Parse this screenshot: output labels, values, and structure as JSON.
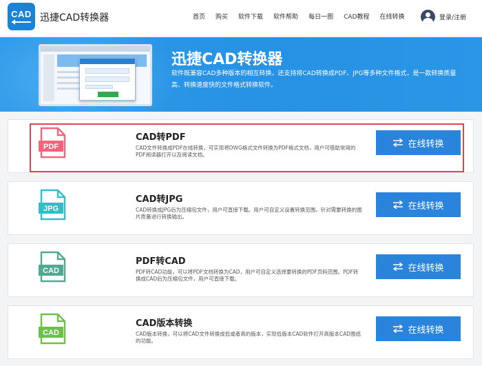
{
  "header": {
    "logo_text": "CAD",
    "brand": "迅捷CAD转换器",
    "nav": [
      "首页",
      "购买",
      "软件下载",
      "软件帮助",
      "每日一图",
      "CAD教程",
      "在线转换"
    ],
    "login": "登录/注册"
  },
  "banner": {
    "title": "迅捷CAD转换器",
    "description": "软件既兼容CAD多种版本的相互转换，还支持将CAD转换成PDF、JPG等多种文件格式，是一款转换质量高、转换速度快的文件格式转换软件。"
  },
  "cards": [
    {
      "title": "CAD转PDF",
      "icon_label": "PDF",
      "icon": "pdf-file-icon",
      "icon_color": "#f2647a",
      "description": "CAD文件转换成PDF在线转换，可实现将DWG格式文件转换为PDF格式文档，用户可借助常用的PDF阅读器打开以及阅读文档。",
      "button": "在线转换"
    },
    {
      "title": "CAD转JPG",
      "icon_label": "JPG",
      "icon": "jpg-file-icon",
      "icon_color": "#2ec0c4",
      "description": "CAD转换成JPG后为压缩包文件，用户可直接下载。用户可自定义设置转换范围，针对需要转换的图片质量进行转换输出。",
      "button": "在线转换"
    },
    {
      "title": "PDF转CAD",
      "icon_label": "CAD",
      "icon": "cad-file-icon",
      "icon_color": "#4fa88f",
      "description": "PDF转CAD功能，可以将PDF文档转换为CAD，用户可自定义选择要转换的PDF页码范围。PDF转换成CAD后为压缩包文件，用户可直接下载。",
      "button": "在线转换"
    },
    {
      "title": "CAD版本转换",
      "icon_label": "CAD",
      "icon": "cad-file-icon",
      "icon_color": "#6cc04a",
      "description": "CAD版本转换，可以将CAD文件转换成低或者高的版本，实现低版本CAD软件打开高版本CAD图纸的功能。",
      "button": "在线转换"
    }
  ],
  "colors": {
    "brand_blue": "#1a82d8",
    "button_blue": "#2a84dc",
    "highlight_red": "#e2424d"
  }
}
